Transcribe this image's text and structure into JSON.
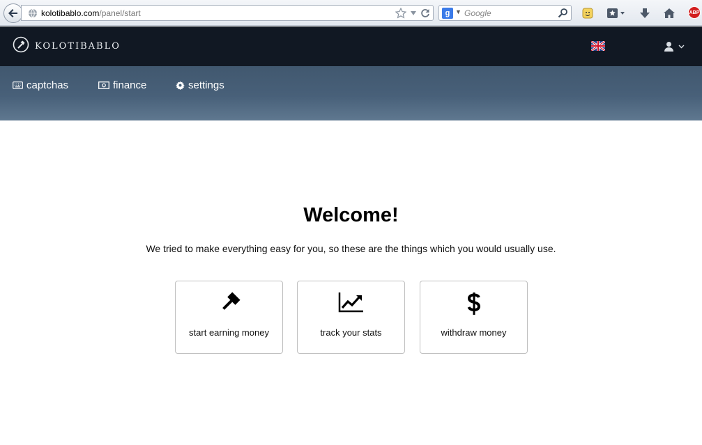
{
  "browser": {
    "url_host": "kolotibablo.com",
    "url_path": "/panel/start",
    "search_placeholder": "Google",
    "search_engine_badge": "g",
    "abp_label": "ABP"
  },
  "site": {
    "logo_text": "kolotibablo",
    "language": "English (UK flag)"
  },
  "nav": {
    "items": [
      {
        "label": "captchas",
        "icon": "keyboard-icon"
      },
      {
        "label": "finance",
        "icon": "money-icon"
      },
      {
        "label": "settings",
        "icon": "gear-icon"
      }
    ]
  },
  "main": {
    "title": "Welcome!",
    "subtitle": "We tried to make everything easy for you, so these are the things which you would usually use.",
    "cards": [
      {
        "label": "start earning money",
        "icon": "gavel-icon"
      },
      {
        "label": "track your stats",
        "icon": "line-chart-icon"
      },
      {
        "label": "withdraw money",
        "icon": "dollar-icon"
      }
    ]
  }
}
